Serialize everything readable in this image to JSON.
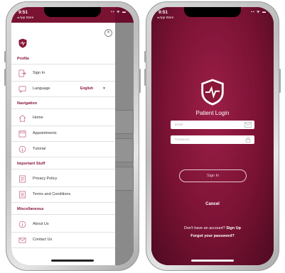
{
  "status": {
    "time": "9:51",
    "back_label": "◂ App Store",
    "signal_icons": "▪▪ ᯤ ▬"
  },
  "drawer": {
    "sections": [
      {
        "title": "Profile",
        "items": [
          {
            "label": "Sign In",
            "icon": "sign-in-icon"
          },
          {
            "label": "Language",
            "icon": "language-icon",
            "value": "English"
          }
        ]
      },
      {
        "title": "Navigation",
        "items": [
          {
            "label": "Home",
            "icon": "home-icon"
          },
          {
            "label": "Appointments",
            "icon": "appointments-icon"
          },
          {
            "label": "Tutorial",
            "icon": "tutorial-icon"
          }
        ]
      },
      {
        "title": "Important Stuff",
        "items": [
          {
            "label": "Privacy Policy",
            "icon": "privacy-icon"
          },
          {
            "label": "Terms and Conditions",
            "icon": "terms-icon"
          }
        ]
      },
      {
        "title": "Miscellaneous",
        "items": [
          {
            "label": "About Us",
            "icon": "about-icon"
          },
          {
            "label": "Contact Us",
            "icon": "contact-icon"
          }
        ]
      }
    ]
  },
  "login": {
    "title": "Patient Login",
    "email_placeholder": "Email",
    "password_placeholder": "Password",
    "signin_label": "Sign In",
    "cancel_label": "Cancel",
    "no_account_text": "Don't have an account?",
    "signup_label": "Sign Up",
    "forgot_label": "Forgot your password?"
  },
  "colors": {
    "brand": "#7a1232",
    "accent": "#8a1638"
  }
}
